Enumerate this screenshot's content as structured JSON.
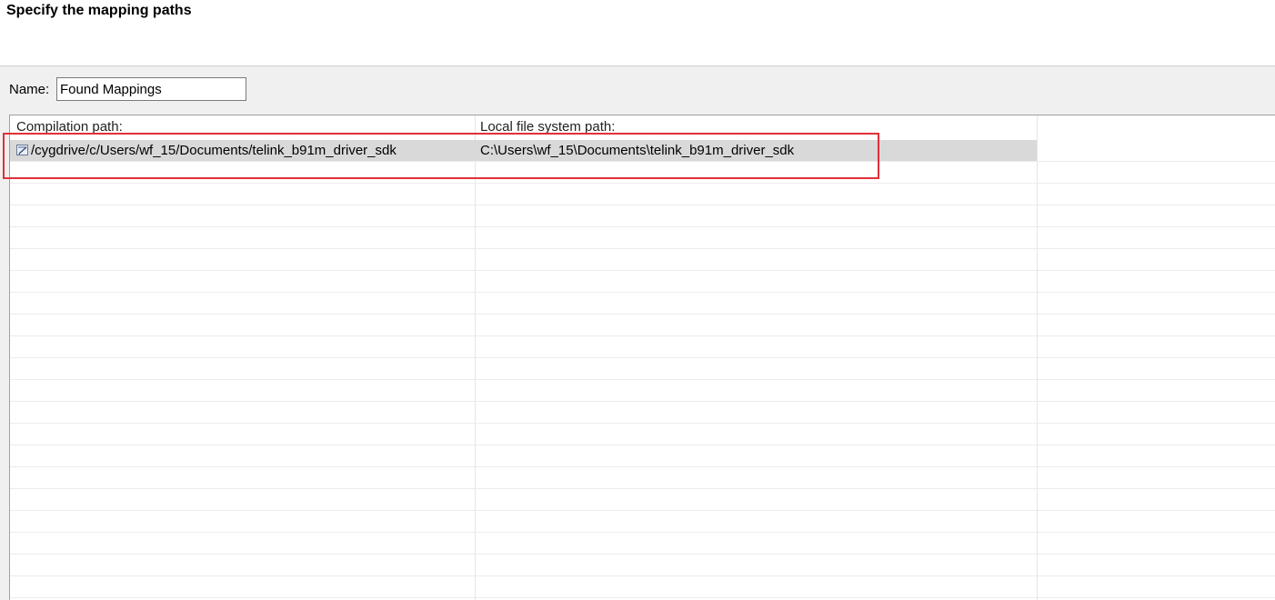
{
  "header": {
    "title": "Specify the mapping paths"
  },
  "name_field": {
    "label": "Name:",
    "value": "Found Mappings"
  },
  "table": {
    "columns": [
      {
        "label": "Compilation path:"
      },
      {
        "label": "Local file system path:"
      }
    ],
    "rows": [
      {
        "icon": "path-mapping-icon",
        "compilation_path": "/cygdrive/c/Users/wf_15/Documents/telink_b91m_driver_sdk",
        "local_path": "C:\\Users\\wf_15\\Documents\\telink_b91m_driver_sdk",
        "selected": true
      }
    ]
  },
  "colors": {
    "selection": "#d9d9d9",
    "highlight_annotation": "#e0303a"
  }
}
